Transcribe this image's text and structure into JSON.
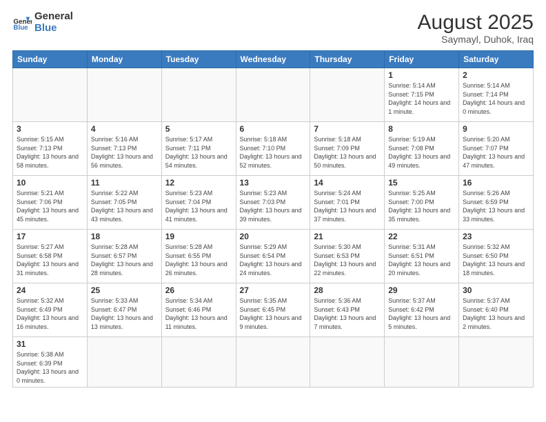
{
  "header": {
    "logo_general": "General",
    "logo_blue": "Blue",
    "month_title": "August 2025",
    "location": "Saymayl, Duhok, Iraq"
  },
  "weekdays": [
    "Sunday",
    "Monday",
    "Tuesday",
    "Wednesday",
    "Thursday",
    "Friday",
    "Saturday"
  ],
  "weeks": [
    [
      {
        "day": "",
        "info": ""
      },
      {
        "day": "",
        "info": ""
      },
      {
        "day": "",
        "info": ""
      },
      {
        "day": "",
        "info": ""
      },
      {
        "day": "",
        "info": ""
      },
      {
        "day": "1",
        "info": "Sunrise: 5:14 AM\nSunset: 7:15 PM\nDaylight: 14 hours\nand 1 minute."
      },
      {
        "day": "2",
        "info": "Sunrise: 5:14 AM\nSunset: 7:14 PM\nDaylight: 14 hours\nand 0 minutes."
      }
    ],
    [
      {
        "day": "3",
        "info": "Sunrise: 5:15 AM\nSunset: 7:13 PM\nDaylight: 13 hours\nand 58 minutes."
      },
      {
        "day": "4",
        "info": "Sunrise: 5:16 AM\nSunset: 7:13 PM\nDaylight: 13 hours\nand 56 minutes."
      },
      {
        "day": "5",
        "info": "Sunrise: 5:17 AM\nSunset: 7:11 PM\nDaylight: 13 hours\nand 54 minutes."
      },
      {
        "day": "6",
        "info": "Sunrise: 5:18 AM\nSunset: 7:10 PM\nDaylight: 13 hours\nand 52 minutes."
      },
      {
        "day": "7",
        "info": "Sunrise: 5:18 AM\nSunset: 7:09 PM\nDaylight: 13 hours\nand 50 minutes."
      },
      {
        "day": "8",
        "info": "Sunrise: 5:19 AM\nSunset: 7:08 PM\nDaylight: 13 hours\nand 49 minutes."
      },
      {
        "day": "9",
        "info": "Sunrise: 5:20 AM\nSunset: 7:07 PM\nDaylight: 13 hours\nand 47 minutes."
      }
    ],
    [
      {
        "day": "10",
        "info": "Sunrise: 5:21 AM\nSunset: 7:06 PM\nDaylight: 13 hours\nand 45 minutes."
      },
      {
        "day": "11",
        "info": "Sunrise: 5:22 AM\nSunset: 7:05 PM\nDaylight: 13 hours\nand 43 minutes."
      },
      {
        "day": "12",
        "info": "Sunrise: 5:23 AM\nSunset: 7:04 PM\nDaylight: 13 hours\nand 41 minutes."
      },
      {
        "day": "13",
        "info": "Sunrise: 5:23 AM\nSunset: 7:03 PM\nDaylight: 13 hours\nand 39 minutes."
      },
      {
        "day": "14",
        "info": "Sunrise: 5:24 AM\nSunset: 7:01 PM\nDaylight: 13 hours\nand 37 minutes."
      },
      {
        "day": "15",
        "info": "Sunrise: 5:25 AM\nSunset: 7:00 PM\nDaylight: 13 hours\nand 35 minutes."
      },
      {
        "day": "16",
        "info": "Sunrise: 5:26 AM\nSunset: 6:59 PM\nDaylight: 13 hours\nand 33 minutes."
      }
    ],
    [
      {
        "day": "17",
        "info": "Sunrise: 5:27 AM\nSunset: 6:58 PM\nDaylight: 13 hours\nand 31 minutes."
      },
      {
        "day": "18",
        "info": "Sunrise: 5:28 AM\nSunset: 6:57 PM\nDaylight: 13 hours\nand 28 minutes."
      },
      {
        "day": "19",
        "info": "Sunrise: 5:28 AM\nSunset: 6:55 PM\nDaylight: 13 hours\nand 26 minutes."
      },
      {
        "day": "20",
        "info": "Sunrise: 5:29 AM\nSunset: 6:54 PM\nDaylight: 13 hours\nand 24 minutes."
      },
      {
        "day": "21",
        "info": "Sunrise: 5:30 AM\nSunset: 6:53 PM\nDaylight: 13 hours\nand 22 minutes."
      },
      {
        "day": "22",
        "info": "Sunrise: 5:31 AM\nSunset: 6:51 PM\nDaylight: 13 hours\nand 20 minutes."
      },
      {
        "day": "23",
        "info": "Sunrise: 5:32 AM\nSunset: 6:50 PM\nDaylight: 13 hours\nand 18 minutes."
      }
    ],
    [
      {
        "day": "24",
        "info": "Sunrise: 5:32 AM\nSunset: 6:49 PM\nDaylight: 13 hours\nand 16 minutes."
      },
      {
        "day": "25",
        "info": "Sunrise: 5:33 AM\nSunset: 6:47 PM\nDaylight: 13 hours\nand 13 minutes."
      },
      {
        "day": "26",
        "info": "Sunrise: 5:34 AM\nSunset: 6:46 PM\nDaylight: 13 hours\nand 11 minutes."
      },
      {
        "day": "27",
        "info": "Sunrise: 5:35 AM\nSunset: 6:45 PM\nDaylight: 13 hours\nand 9 minutes."
      },
      {
        "day": "28",
        "info": "Sunrise: 5:36 AM\nSunset: 6:43 PM\nDaylight: 13 hours\nand 7 minutes."
      },
      {
        "day": "29",
        "info": "Sunrise: 5:37 AM\nSunset: 6:42 PM\nDaylight: 13 hours\nand 5 minutes."
      },
      {
        "day": "30",
        "info": "Sunrise: 5:37 AM\nSunset: 6:40 PM\nDaylight: 13 hours\nand 2 minutes."
      }
    ],
    [
      {
        "day": "31",
        "info": "Sunrise: 5:38 AM\nSunset: 6:39 PM\nDaylight: 13 hours\nand 0 minutes."
      },
      {
        "day": "",
        "info": ""
      },
      {
        "day": "",
        "info": ""
      },
      {
        "day": "",
        "info": ""
      },
      {
        "day": "",
        "info": ""
      },
      {
        "day": "",
        "info": ""
      },
      {
        "day": "",
        "info": ""
      }
    ]
  ]
}
